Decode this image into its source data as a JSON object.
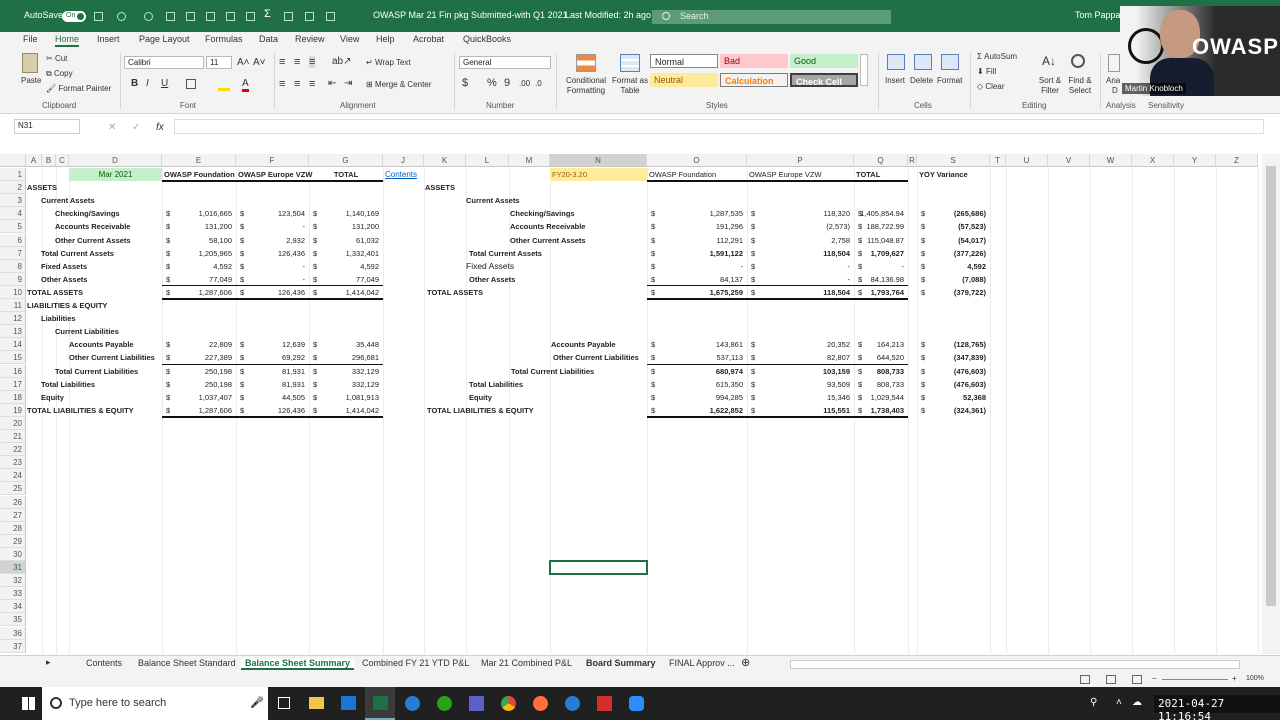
{
  "title_bar": {
    "autosave": "AutoSave",
    "toggle": "On",
    "file_title": "OWASP Mar 21 Fin pkg Submitted-with Q1 2021",
    "modified": "Last Modified: 2h ago",
    "search_placeholder": "Search",
    "user": "Tom Pappas"
  },
  "menu": {
    "items": [
      "File",
      "Home",
      "Insert",
      "Page Layout",
      "Formulas",
      "Data",
      "Review",
      "View",
      "Help",
      "Acrobat",
      "QuickBooks"
    ],
    "active": "Home"
  },
  "ribbon": {
    "clipboard": {
      "paste": "Paste",
      "cut": "Cut",
      "copy": "Copy",
      "format_painter": "Format Painter",
      "label": "Clipboard"
    },
    "font": {
      "name": "Calibri",
      "size": "11",
      "label": "Font"
    },
    "alignment": {
      "wrap": "Wrap Text",
      "merge": "Merge & Center",
      "label": "Alignment"
    },
    "number": {
      "format": "General",
      "label": "Number"
    },
    "styles": {
      "conditional": "Conditional Formatting",
      "format_table": "Format as Table",
      "normal": "Normal",
      "bad": "Bad",
      "good": "Good",
      "neutral": "Neutral",
      "calculation": "Calculation",
      "check": "Check Cell",
      "label": "Styles"
    },
    "cells": {
      "insert": "Insert",
      "delete": "Delete",
      "format": "Format",
      "label": "Cells"
    },
    "editing": {
      "autosum": "AutoSum",
      "fill": "Fill",
      "clear": "Clear",
      "sort": "Sort & Filter",
      "find": "Find & Select",
      "label": "Editing"
    },
    "analysis": {
      "label": "Analysis",
      "sensitivity": "Sensitivity",
      "ana": "Ana",
      "d": "D"
    }
  },
  "formula_bar": {
    "name_box": "N31",
    "fx": "fx"
  },
  "columns": [
    "A",
    "B",
    "C",
    "D",
    "E",
    "F",
    "G",
    "J",
    "K",
    "L",
    "M",
    "N",
    "O",
    "P",
    "Q",
    "R",
    "S",
    "T",
    "U",
    "V",
    "W",
    "X",
    "Y",
    "Z"
  ],
  "rows": [
    "1",
    "2",
    "3",
    "4",
    "5",
    "6",
    "7",
    "8",
    "9",
    "10",
    "11",
    "12",
    "13",
    "14",
    "15",
    "16",
    "17",
    "18",
    "19",
    "20",
    "21",
    "22",
    "23",
    "24",
    "25",
    "26",
    "27",
    "28",
    "29",
    "30",
    "31",
    "32",
    "33",
    "34",
    "35",
    "36",
    "37"
  ],
  "left": {
    "header": {
      "date": "Mar 2021",
      "foundation": "OWASP Foundation",
      "europe": "OWASP Europe VZW",
      "total": "TOTAL",
      "contents": "Contents"
    },
    "lines": [
      {
        "label": "ASSETS",
        "e": "",
        "f": "",
        "g": ""
      },
      {
        "label": "Current Assets",
        "e": "",
        "f": "",
        "g": ""
      },
      {
        "label": "Checking/Savings",
        "e": "1,016,665",
        "f": "123,504",
        "g": "1,140,169"
      },
      {
        "label": "Accounts Receivable",
        "e": "131,200",
        "f": "-",
        "g": "131,200"
      },
      {
        "label": "Other Current Assets",
        "e": "58,100",
        "f": "2,932",
        "g": "61,032"
      },
      {
        "label": "Total Current Assets",
        "e": "1,205,965",
        "f": "126,436",
        "g": "1,332,401"
      },
      {
        "label": "Fixed Assets",
        "e": "4,592",
        "f": "-",
        "g": "4,592"
      },
      {
        "label": "Other Assets",
        "e": "77,049",
        "f": "-",
        "g": "77,049"
      },
      {
        "label": "TOTAL ASSETS",
        "e": "1,287,606",
        "f": "126,436",
        "g": "1,414,042"
      },
      {
        "label": "LIABILITIES & EQUITY",
        "e": "",
        "f": "",
        "g": ""
      },
      {
        "label": "Liabilities",
        "e": "",
        "f": "",
        "g": ""
      },
      {
        "label": "Current Liabilities",
        "e": "",
        "f": "",
        "g": ""
      },
      {
        "label": "Accounts Payable",
        "e": "22,809",
        "f": "12,639",
        "g": "35,448"
      },
      {
        "label": "Other Current Liabilities",
        "e": "227,389",
        "f": "69,292",
        "g": "296,681"
      },
      {
        "label": "Total Current Liabilities",
        "e": "250,198",
        "f": "81,931",
        "g": "332,129"
      },
      {
        "label": "Total Liabilities",
        "e": "250,198",
        "f": "81,931",
        "g": "332,129"
      },
      {
        "label": "Equity",
        "e": "1,037,407",
        "f": "44,505",
        "g": "1,081,913"
      },
      {
        "label": "TOTAL LIABILITIES & EQUITY",
        "e": "1,287,606",
        "f": "126,436",
        "g": "1,414,042"
      }
    ]
  },
  "right": {
    "header": {
      "period": "FY20-3.20",
      "foundation": "OWASP Foundation",
      "europe": "OWASP Europe VZW",
      "total": "TOTAL",
      "yoy": "YOY Variance"
    },
    "lines": [
      {
        "label": "ASSETS",
        "o": "",
        "p": "",
        "q": "",
        "s": ""
      },
      {
        "label": "Current Assets",
        "o": "",
        "p": "",
        "q": "",
        "s": ""
      },
      {
        "label": "Checking/Savings",
        "o": "1,287,535",
        "p": "118,320",
        "q": "1,405,854.94",
        "s": "(265,686)"
      },
      {
        "label": "Accounts Receivable",
        "o": "191,296",
        "p": "(2,573)",
        "q": "188,722.99",
        "s": "(57,523)"
      },
      {
        "label": "Other Current Assets",
        "o": "112,291",
        "p": "2,758",
        "q": "115,048.87",
        "s": "(54,017)"
      },
      {
        "label": "Total Current Assets",
        "o": "1,591,122",
        "p": "118,504",
        "q": "1,709,627",
        "s": "(377,226)"
      },
      {
        "label": "Fixed Assets",
        "o": "-",
        "p": "-",
        "q": "-",
        "s": "4,592"
      },
      {
        "label": "Other Assets",
        "o": "84,137",
        "p": "-",
        "q": "84,136.98",
        "s": "(7,088)"
      },
      {
        "label": "TOTAL ASSETS",
        "o": "1,675,259",
        "p": "118,504",
        "q": "1,793,764",
        "s": "(379,722)"
      },
      {
        "label": "",
        "o": "",
        "p": "",
        "q": "",
        "s": ""
      },
      {
        "label": "",
        "o": "",
        "p": "",
        "q": "",
        "s": ""
      },
      {
        "label": "",
        "o": "",
        "p": "",
        "q": "",
        "s": ""
      },
      {
        "label": "Accounts Payable",
        "o": "143,861",
        "p": "20,352",
        "q": "164,213",
        "s": "(128,765)"
      },
      {
        "label": "Other Current Liabilities",
        "o": "537,113",
        "p": "82,807",
        "q": "644,520",
        "s": "(347,839)"
      },
      {
        "label": "Total Current Liabilities",
        "o": "680,974",
        "p": "103,159",
        "q": "808,733",
        "s": "(476,603)"
      },
      {
        "label": "Total Liabilities",
        "o": "615,350",
        "p": "93,509",
        "q": "808,733",
        "s": "(476,603)"
      },
      {
        "label": "Equity",
        "o": "994,285",
        "p": "15,346",
        "q": "1,029,544",
        "s": "52,368"
      },
      {
        "label": "TOTAL LIABILITIES & EQUITY",
        "o": "1,622,852",
        "p": "115,551",
        "q": "1,738,403",
        "s": "(324,361)"
      }
    ]
  },
  "dollar": "$",
  "sheet_tabs": [
    "Contents",
    "Balance Sheet Standard",
    "Balance Sheet Summary",
    "Combined FY 21 YTD P&L",
    "Mar 21 Combined P&L",
    "Board Summary",
    "FINAL Approv ..."
  ],
  "active_tab": "Balance Sheet Summary",
  "status": {
    "zoom": "100%"
  },
  "taskbar": {
    "search": "Type here to search",
    "datetime": "2021-04-27 11:16:54"
  },
  "webcam": {
    "name": "Martin Knobloch",
    "brand": "OWASP"
  },
  "colors": {
    "excel_green": "#1f7145",
    "date_fill": "#c6efce",
    "fy_fill": "#ffeb9c",
    "bad": "#ffc7ce",
    "neutral": "#ffeb9c",
    "good": "#c6efce"
  }
}
